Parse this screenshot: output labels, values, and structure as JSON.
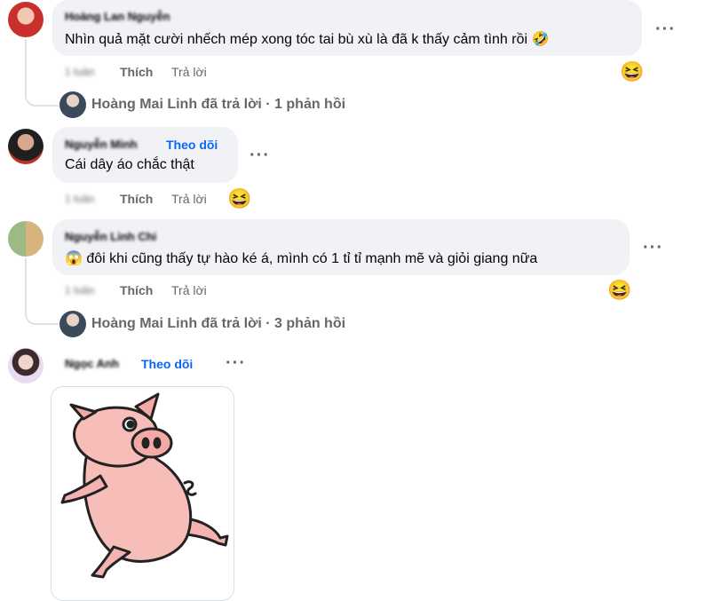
{
  "comments": [
    {
      "author": "Hoàng Lan Nguyễn",
      "text": "Nhìn quả mặt cười nhếch mép xong tóc tai bù xù là đã k thấy cảm tình rồi",
      "inline_emoji": "🤣",
      "time": "1 tuần",
      "like": "Thích",
      "reply": "Trả lời",
      "reaction": "😆",
      "replies_link": "Hoàng Mai Linh đã trả lời · 1 phản hồi"
    },
    {
      "author": "Nguyễn Minh",
      "follow": "Theo dõi",
      "text": "Cái dây áo chắc thật",
      "time": "1 tuần",
      "like": "Thích",
      "reply": "Trả lời",
      "reaction": "😆"
    },
    {
      "author": "Nguyễn Linh Chi",
      "text_emoji": "😱",
      "text": "đôi khi cũng thấy tự hào ké á, mình có 1 tỉ tỉ mạnh mẽ và giỏi giang nữa",
      "time": "1 tuần",
      "like": "Thích",
      "reply": "Trả lời",
      "reaction": "😆",
      "replies_link": "Hoàng Mai Linh đã trả lời · 3 phản hồi"
    },
    {
      "author": "Ngọc Anh",
      "follow": "Theo dõi"
    }
  ],
  "more_label": "···"
}
